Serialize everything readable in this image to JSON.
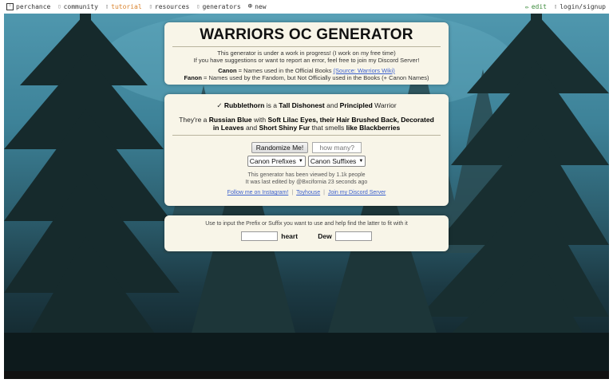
{
  "nav": {
    "brand": "perchance",
    "community": "community",
    "tutorial": "tutorial",
    "resources": "resources",
    "generators": "generators",
    "new": "new",
    "edit": "edit",
    "login": "login/signup"
  },
  "header": {
    "title": "WARRIORS OC GENERATOR",
    "wip": "This generator is under a work in progress! (I work on my free time)",
    "suggest": "If you have suggestions or want to report an error, feel free to join my Discord Server!",
    "canon_label": "Canon",
    "canon_text": " = Names used in the Official Books ",
    "canon_source": "(Source: Warriors Wiki)",
    "fanon_label": "Fanon",
    "fanon_text": " = Names used by the Fandom, but Not Officially used in the Books (+ Canon Names)"
  },
  "result": {
    "icon": "✓",
    "name": "Rubblethorn",
    "is_a": " is a ",
    "trait1": "Tall Dishonest",
    "and": " and ",
    "trait2": "Principled",
    "rank": " Warrior",
    "theyre": "They're a ",
    "breed": "Russian Blue",
    "with": " with ",
    "features": "Soft Lilac Eyes, their Hair Brushed Back, Decorated in Leaves",
    "and2": " and ",
    "fur": "Short Shiny Fur",
    "smells": " that smells ",
    "scent": "like Blackberries"
  },
  "controls": {
    "randomize": "Randomize Me!",
    "how_many_placeholder": "how many?",
    "prefix_select": "Canon Prefixes",
    "suffix_select": "Canon Suffixes"
  },
  "stats": {
    "viewed": "This generator has been viewed by 1.1k people",
    "edited": "It was last edited by @Bxcifornia 23 seconds ago"
  },
  "links": {
    "instagram": "Follow me on Instagram!",
    "toyhouse": "Toyhouse",
    "discord": "Join my Discord Server"
  },
  "fitter": {
    "help": "Use to input the Prefix or Suffix you want to use and help find the latter to fit with it",
    "word1": "heart",
    "word2": "Dew"
  },
  "colors": {
    "panel_bg": "#f8f5e8",
    "link": "#3a5fcd",
    "tutorial_accent": "#d9822b",
    "edit_accent": "#3a8a3a"
  }
}
